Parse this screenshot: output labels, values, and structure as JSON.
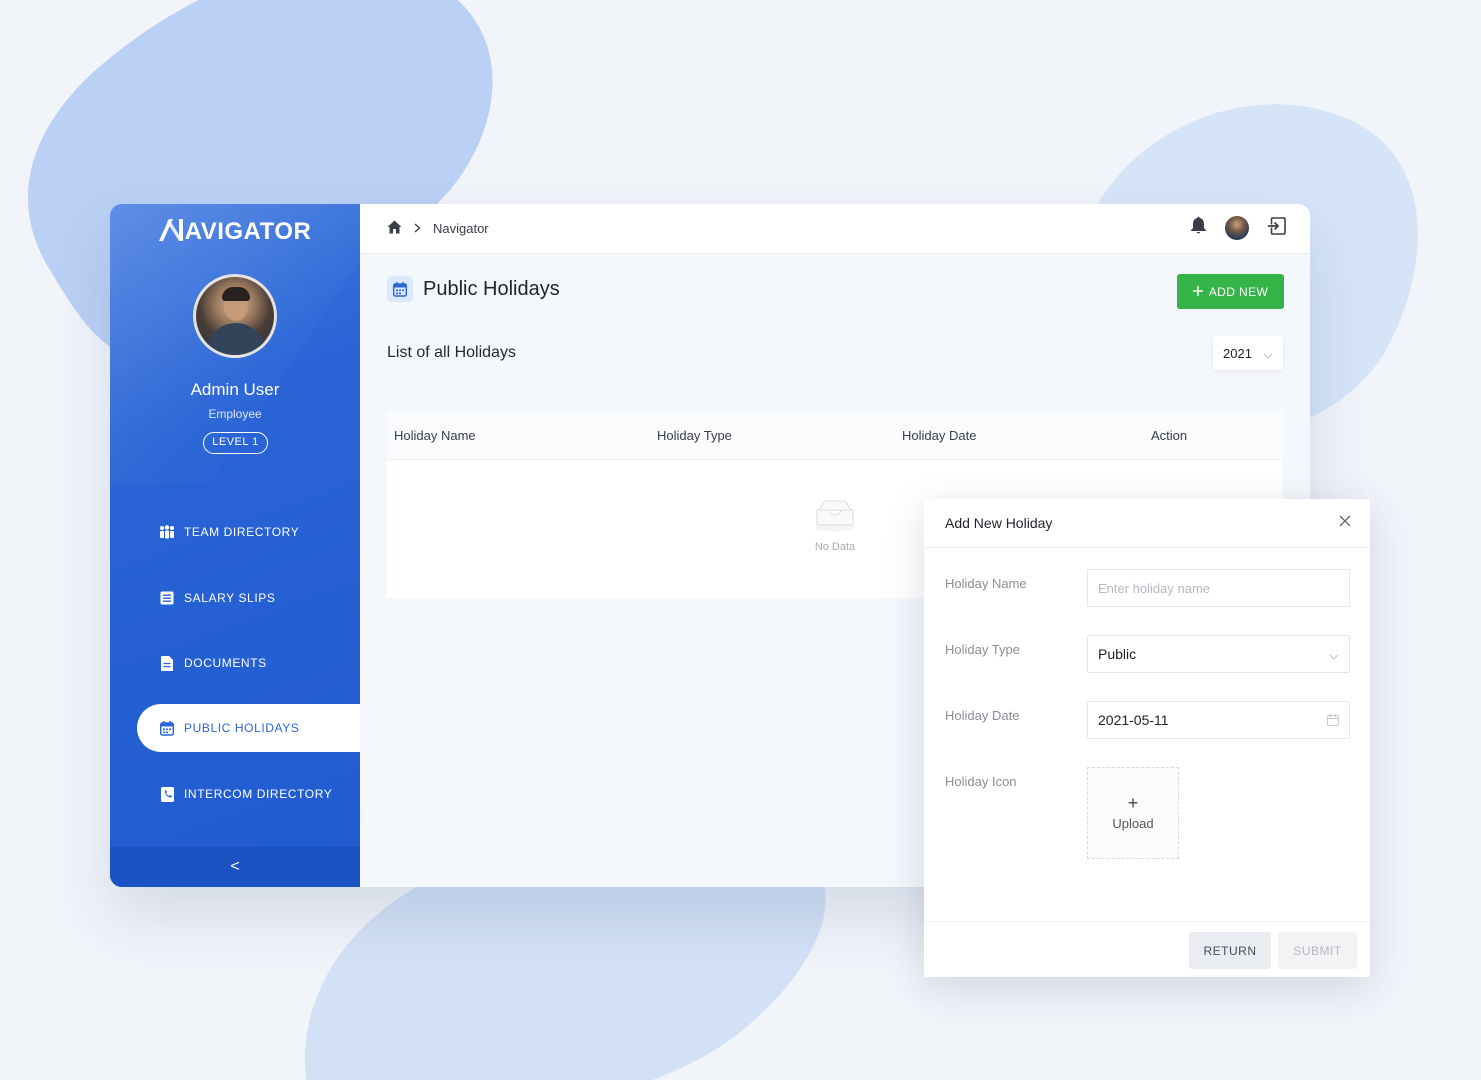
{
  "app": {
    "logo_text": "AVIGATOR",
    "logo_mark": "N"
  },
  "colors": {
    "primary": "#2a64d6",
    "success": "#35b548",
    "background": "#f1f4f9"
  },
  "user": {
    "name": "Admin User",
    "role": "Employee",
    "level": "LEVEL 1"
  },
  "sidebar": {
    "items": [
      {
        "label": "TEAM DIRECTORY",
        "icon": "team-icon",
        "active": false
      },
      {
        "label": "SALARY SLIPS",
        "icon": "salary-slip-icon",
        "active": false
      },
      {
        "label": "DOCUMENTS",
        "icon": "document-icon",
        "active": false
      },
      {
        "label": "PUBLIC HOLIDAYS",
        "icon": "calendar-icon",
        "active": true
      },
      {
        "label": "INTERCOM DIRECTORY",
        "icon": "phone-book-icon",
        "active": false
      }
    ],
    "collapse_glyph": "<"
  },
  "header": {
    "breadcrumb": [
      "Navigator"
    ],
    "icons": [
      "bell-icon",
      "avatar",
      "logout-icon"
    ]
  },
  "page": {
    "title": "Public Holidays",
    "add_button": "ADD NEW",
    "list_title": "List of all Holidays",
    "year": "2021"
  },
  "table": {
    "columns": [
      "Holiday Name",
      "Holiday Type",
      "Holiday Date",
      "Action"
    ],
    "rows": [],
    "empty_text": "No Data"
  },
  "modal": {
    "title": "Add New Holiday",
    "fields": {
      "name": {
        "label": "Holiday Name",
        "placeholder": "Enter holiday name",
        "value": ""
      },
      "type": {
        "label": "Holiday Type",
        "value": "Public"
      },
      "date": {
        "label": "Holiday Date",
        "value": "2021-05-11"
      },
      "icon": {
        "label": "Holiday Icon",
        "upload_label": "Upload"
      }
    },
    "return_button": "RETURN",
    "submit_button": "SUBMIT"
  }
}
